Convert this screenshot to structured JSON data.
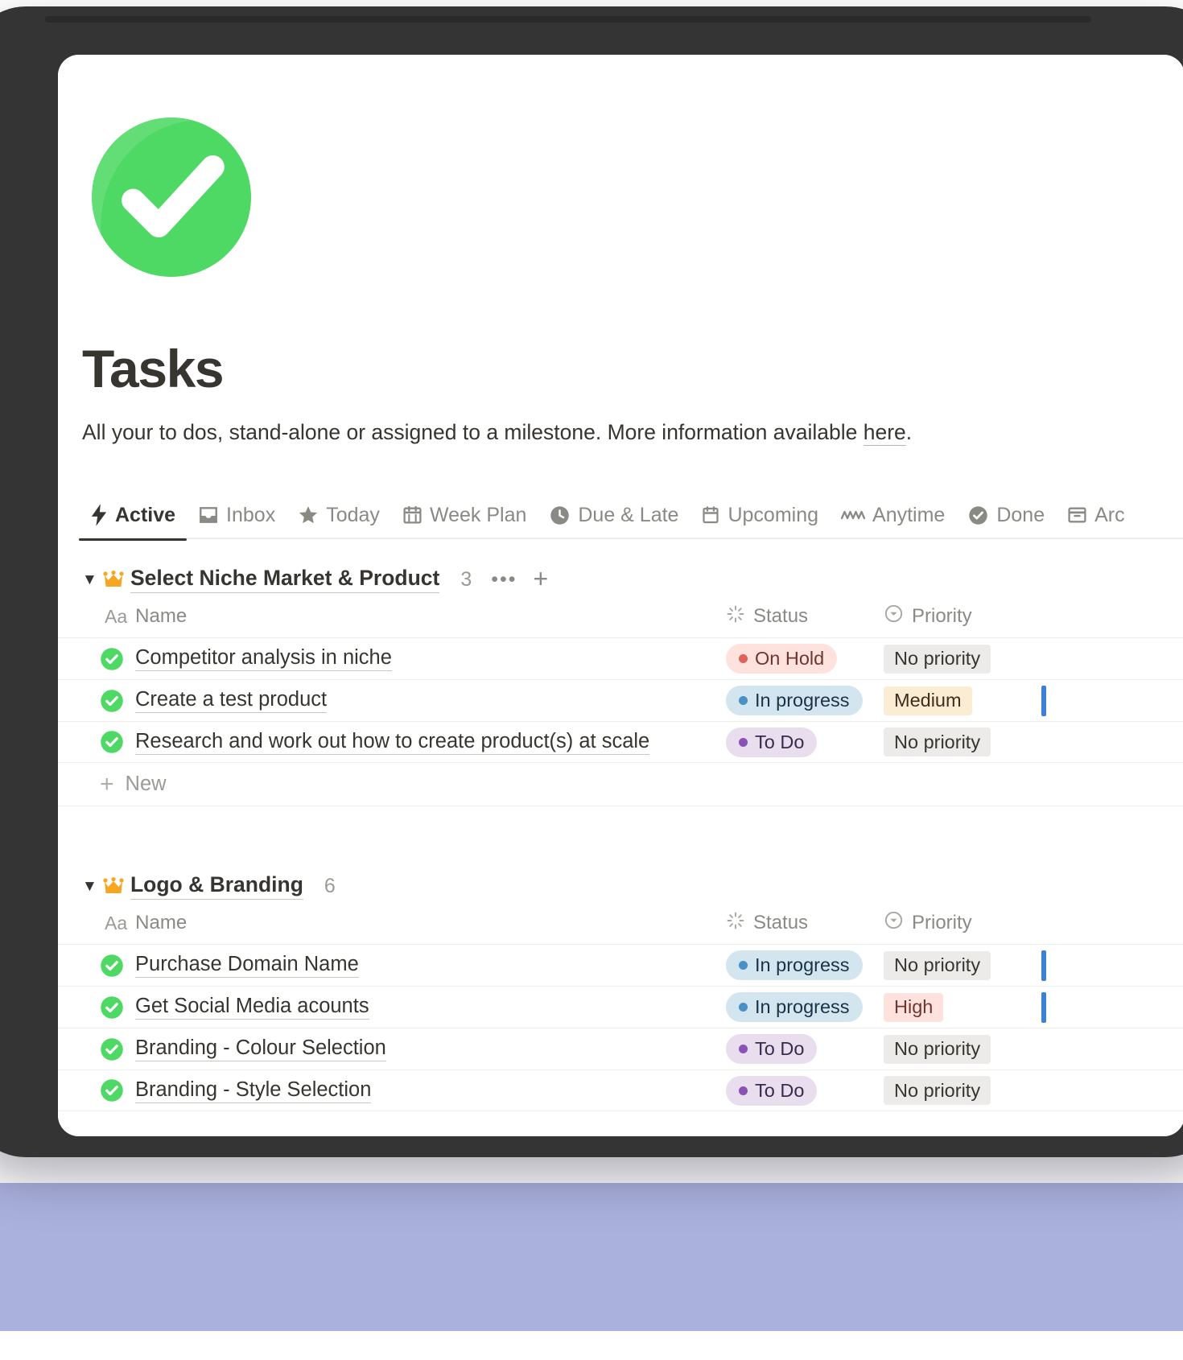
{
  "page": {
    "icon": "green-check-circle-icon",
    "title": "Tasks",
    "description_before": "All your to dos, stand-alone or assigned to a milestone. More information available ",
    "description_link": "here",
    "description_after": "."
  },
  "tabs": [
    {
      "label": "Active",
      "icon": "lightning-bolt-icon",
      "active": true
    },
    {
      "label": "Inbox",
      "icon": "inbox-tray-icon",
      "active": false
    },
    {
      "label": "Today",
      "icon": "star-icon",
      "active": false
    },
    {
      "label": "Week Plan",
      "icon": "calendar-grid-icon",
      "active": false
    },
    {
      "label": "Due & Late",
      "icon": "clock-icon",
      "active": false
    },
    {
      "label": "Upcoming",
      "icon": "calendar-icon",
      "active": false
    },
    {
      "label": "Anytime",
      "icon": "waves-icon",
      "active": false
    },
    {
      "label": "Done",
      "icon": "check-circle-icon",
      "active": false
    },
    {
      "label": "Arc",
      "icon": "archive-box-icon",
      "active": false
    }
  ],
  "columns": {
    "name_prefix": "Aa",
    "name": "Name",
    "status": "Status",
    "priority": "Priority",
    "status_icon": "spinner-icon",
    "priority_icon": "chevron-down-circle-icon"
  },
  "new_row_label": "New",
  "groups": [
    {
      "emoji": "crown-emoji",
      "title": "Select Niche Market & Product",
      "count": "3",
      "caret": "▼",
      "more_label": "•••",
      "add_label": "+",
      "show_actions": true,
      "show_new_row": true,
      "rows": [
        {
          "name": "Competitor analysis in niche",
          "status": "On Hold",
          "status_kind": "onhold",
          "priority": "No priority",
          "priority_kind": "none",
          "bar": false
        },
        {
          "name": "Create a test product",
          "status": "In progress",
          "status_kind": "inprog",
          "priority": "Medium",
          "priority_kind": "medium",
          "bar": true
        },
        {
          "name": "Research and work out how to create product(s) at scale",
          "status": "To Do",
          "status_kind": "todo",
          "priority": "No priority",
          "priority_kind": "none",
          "bar": false
        }
      ]
    },
    {
      "emoji": "crown-emoji",
      "title": "Logo & Branding",
      "count": "6",
      "caret": "▼",
      "more_label": "",
      "add_label": "",
      "show_actions": false,
      "show_new_row": false,
      "rows": [
        {
          "name": "Purchase Domain Name",
          "status": "In progress",
          "status_kind": "inprog",
          "priority": "No priority",
          "priority_kind": "none",
          "bar": true
        },
        {
          "name": "Get Social Media acounts",
          "status": "In progress",
          "status_kind": "inprog",
          "priority": "High",
          "priority_kind": "high",
          "bar": true
        },
        {
          "name": "Branding - Colour Selection",
          "status": "To Do",
          "status_kind": "todo",
          "priority": "No priority",
          "priority_kind": "none",
          "bar": false
        },
        {
          "name": "Branding - Style Selection",
          "status": "To Do",
          "status_kind": "todo",
          "priority": "No priority",
          "priority_kind": "none",
          "bar": false
        }
      ]
    }
  ],
  "colors": {
    "accent_green": "#4ed964",
    "crown_orange": "#f5a623",
    "text": "#37352f",
    "muted": "#8a8a85",
    "bezel": "#343434",
    "backdrop": "#aab1dd"
  }
}
